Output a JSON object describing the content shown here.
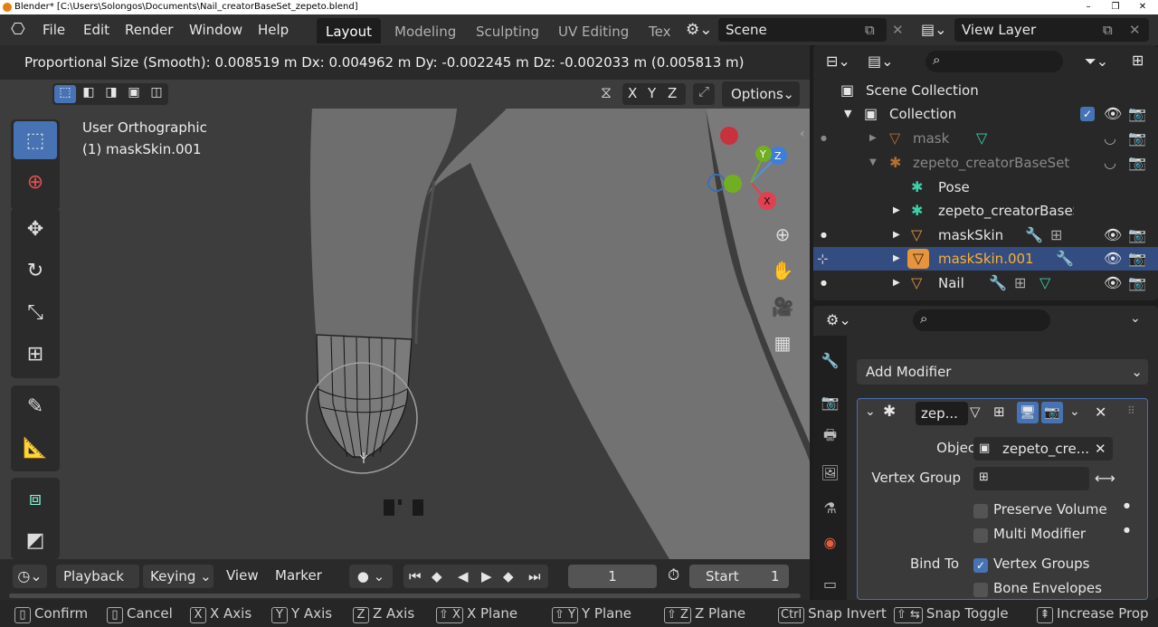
{
  "window": {
    "title": "Blender* [C:\\Users\\Solongos\\Documents\\Nail_creatorBaseSet_zepeto.blend]",
    "controls": [
      "–",
      "❐",
      "✕"
    ]
  },
  "menu": {
    "items": [
      "File",
      "Edit",
      "Render",
      "Window",
      "Help"
    ],
    "workspaces": [
      "Layout",
      "Modeling",
      "Sculpting",
      "UV Editing",
      "Tex"
    ],
    "scene": "Scene",
    "view_layer": "View Layer"
  },
  "viewport": {
    "status": "Proportional Size (Smooth): 0.008519 m   Dx: 0.004962 m   Dy: -0.002245 m   Dz: -0.002033 m (0.005813 m)",
    "view_name": "User Orthographic",
    "object_name": "(1) maskSkin.001",
    "axes": [
      "X",
      "Y",
      "Z"
    ],
    "options_label": "Options",
    "gizmo": {
      "x": "X",
      "y": "Y",
      "z": "Z"
    }
  },
  "timeline": {
    "playback": "Playback",
    "keying": "Keying",
    "view": "View",
    "marker": "Marker",
    "current_frame": "1",
    "start_label": "Start",
    "start_value": "1"
  },
  "statusbar": [
    {
      "key": "",
      "label": "Confirm"
    },
    {
      "key": "",
      "label": "Cancel"
    },
    {
      "key": "X",
      "label": "X Axis"
    },
    {
      "key": "Y",
      "label": "Y Axis"
    },
    {
      "key": "Z",
      "label": "Z Axis"
    },
    {
      "key": "⇧ X",
      "label": "X Plane"
    },
    {
      "key": "⇧ Y",
      "label": "Y Plane"
    },
    {
      "key": "⇧ Z",
      "label": "Z Plane"
    },
    {
      "key": "Ctrl",
      "label": "Snap Invert"
    },
    {
      "key": "⇧ ⇆",
      "label": "Snap Toggle"
    },
    {
      "key": "⇞",
      "label": "Increase Prop"
    }
  ],
  "outliner": {
    "scene_collection": "Scene Collection",
    "rows": [
      {
        "label": "Collection",
        "indent": 1
      },
      {
        "label": "mask",
        "indent": 2
      },
      {
        "label": "zepeto_creatorBaseSet",
        "indent": 2
      },
      {
        "label": "Pose",
        "indent": 3
      },
      {
        "label": "zepeto_creatorBaseSet",
        "indent": 3
      },
      {
        "label": "maskSkin",
        "indent": 2
      },
      {
        "label": "maskSkin.001",
        "indent": 2
      },
      {
        "label": "Nail",
        "indent": 2
      }
    ]
  },
  "properties": {
    "add_modifier": "Add Modifier",
    "modifier_name": "zep...",
    "object_label": "Object",
    "object_value": "zepeto_cre...",
    "vertex_group_label": "Vertex Group",
    "preserve_volume": "Preserve Volume",
    "multi_modifier": "Multi Modifier",
    "bind_to_label": "Bind To",
    "vertex_groups": "Vertex Groups",
    "bone_envelopes": "Bone Envelopes",
    "vertex_groups_checked": true
  },
  "colors": {
    "accent": "#4772b3",
    "selected_row": "#334d80",
    "active_object": "#ffaf29",
    "mesh_icon": "#e8943a",
    "armature_icon": "#3cd1a9"
  }
}
